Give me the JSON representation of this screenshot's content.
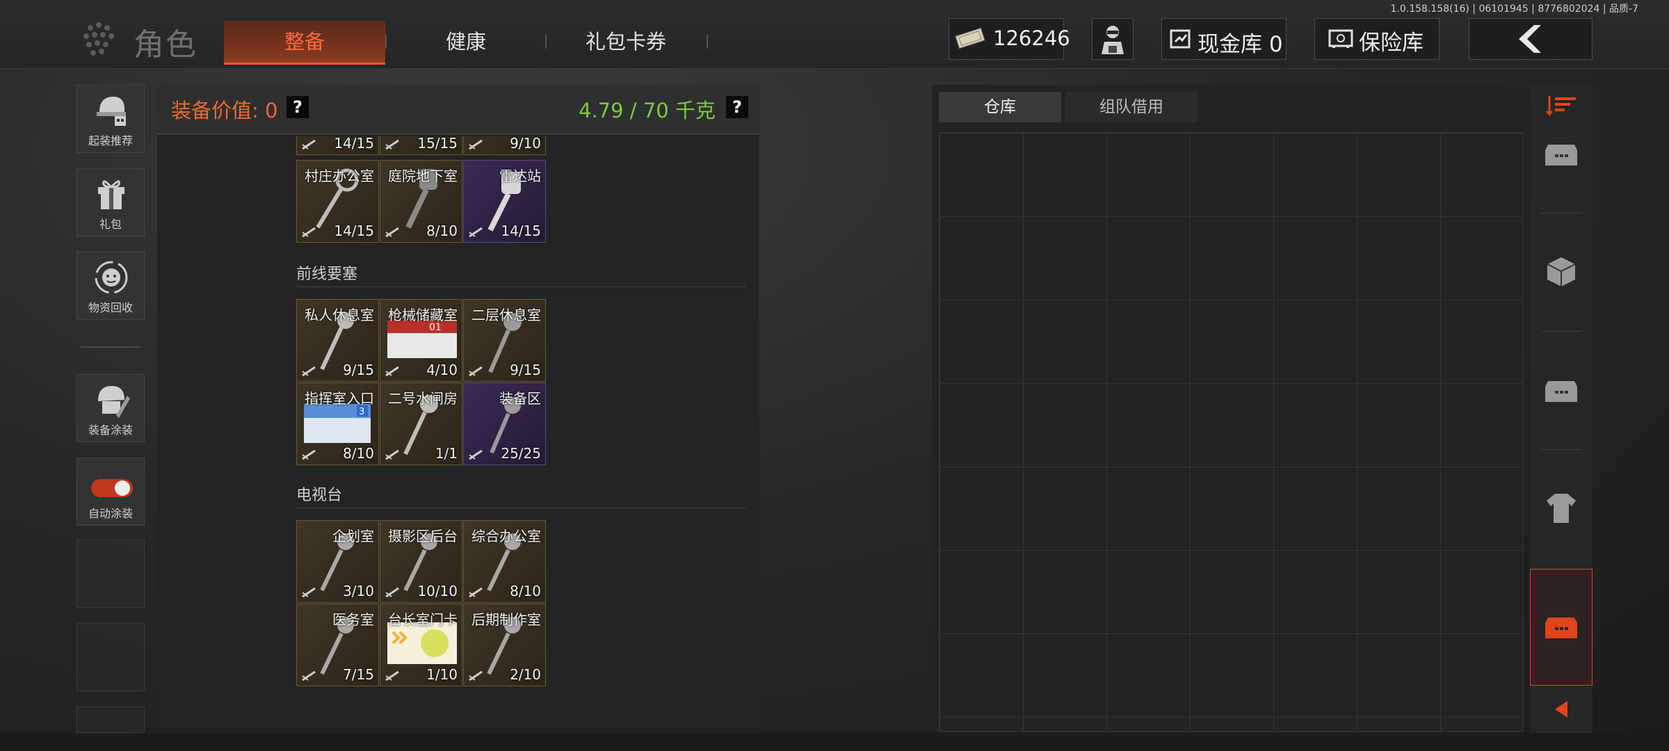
{
  "version_text": "1.0.158.158(16) | 06101945 | 8776802024 | 品质-7",
  "header": {
    "title": "角色",
    "tabs": [
      {
        "label": "整备",
        "active": true
      },
      {
        "label": "健康",
        "active": false
      },
      {
        "label": "礼包卡券",
        "active": false
      }
    ],
    "money": "126246",
    "cash_vault": "现金库 0",
    "safe_vault": "保险库"
  },
  "sidebar": {
    "items": [
      {
        "label": "起装推荐",
        "icon": "helmet-gun-icon"
      },
      {
        "label": "礼包",
        "icon": "gift-icon"
      },
      {
        "label": "物资回收",
        "icon": "recycle-icon"
      },
      {
        "label": "装备涂装",
        "icon": "paint-helmet-icon"
      },
      {
        "label": "自动涂装",
        "icon": "toggle-icon"
      }
    ]
  },
  "equipment": {
    "value_label": "装备价值: 0",
    "weight_label": "4.79 / 70 千克",
    "help": "?",
    "top_counts": [
      "14/15",
      "15/15",
      "9/10"
    ],
    "sections": [
      {
        "title": "",
        "items": [
          {
            "name": "村庄办公室",
            "count": "14/15",
            "rarity": "gold"
          },
          {
            "name": "庭院地下室",
            "count": "8/10",
            "rarity": "gold"
          },
          {
            "name": "雷达站",
            "count": "14/15",
            "rarity": "purple"
          }
        ]
      },
      {
        "title": "前线要塞",
        "items": [
          {
            "name": "私人休息室",
            "count": "9/15",
            "rarity": "gold"
          },
          {
            "name": "枪械储藏室",
            "count": "4/10",
            "rarity": "gold",
            "card": "01"
          },
          {
            "name": "二层休息室",
            "count": "9/15",
            "rarity": "gold"
          },
          {
            "name": "指挥室入口",
            "count": "8/10",
            "rarity": "gold",
            "card": "3"
          },
          {
            "name": "二号水闸房",
            "count": "1/1",
            "rarity": "gold"
          },
          {
            "name": "装备区",
            "count": "25/25",
            "rarity": "purple"
          }
        ]
      },
      {
        "title": "电视台",
        "items": [
          {
            "name": "企划室",
            "count": "3/10",
            "rarity": "gold"
          },
          {
            "name": "摄影区后台",
            "count": "10/10",
            "rarity": "gold"
          },
          {
            "name": "综合办公室",
            "count": "8/10",
            "rarity": "gold"
          },
          {
            "name": "医务室",
            "count": "7/15",
            "rarity": "gold"
          },
          {
            "name": "台长室门卡",
            "count": "1/10",
            "rarity": "gold",
            "card": "yellow"
          },
          {
            "name": "后期制作室",
            "count": "2/10",
            "rarity": "gold"
          }
        ]
      }
    ]
  },
  "warehouse": {
    "tabs": [
      "仓库",
      "组队借用"
    ]
  },
  "colors": {
    "accent": "#ff5a25",
    "weight_green": "#7ecb3a",
    "value_orange": "#f26a2a"
  }
}
